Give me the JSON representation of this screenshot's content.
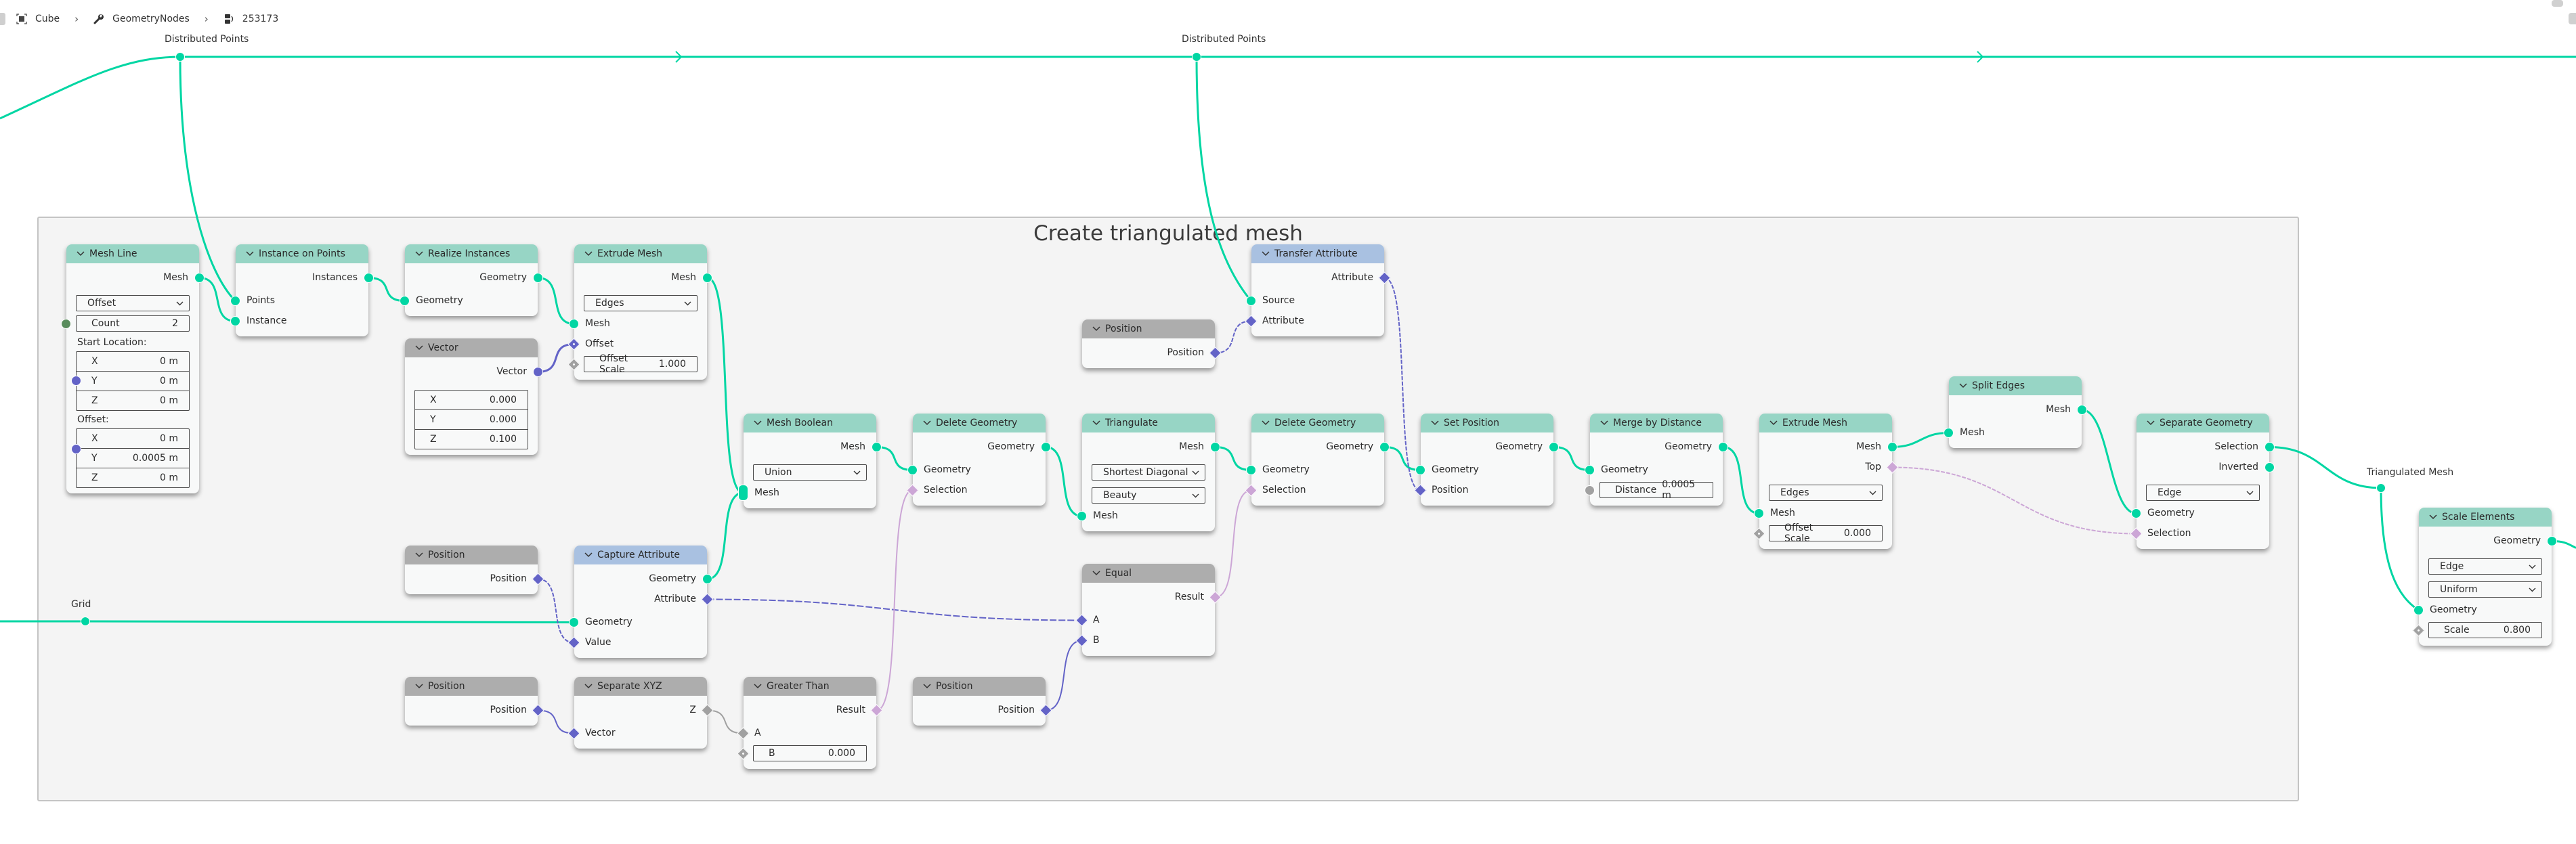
{
  "breadcrumb": {
    "items": [
      {
        "icon": "object-icon",
        "label": "Cube"
      },
      {
        "icon": "wrench-icon",
        "label": "GeometryNodes"
      },
      {
        "icon": "node-tree-icon",
        "label": "253173"
      }
    ]
  },
  "frame": {
    "title": "Create triangulated mesh"
  },
  "reroutes": {
    "distributed_points_1": "Distributed Points",
    "distributed_points_2": "Distributed Points",
    "grid": "Grid",
    "triangulated_mesh": "Triangulated Mesh"
  },
  "colors": {
    "geometry_socket": "#00d6a3",
    "vector_socket": "#6363c7",
    "boolean_socket": "#cca6d6",
    "float_socket": "#a1a1a1",
    "integer_socket": "#598c5c",
    "geometry_header": "#97d5c5",
    "input_header": "#adadad",
    "attribute_header": "#a9c1e1",
    "frame_bg": "#f4f4f4"
  },
  "nodes": {
    "mesh_line": {
      "title": "Mesh Line",
      "out_mesh": "Mesh",
      "mode": "Offset",
      "count_label": "Count",
      "count_value": "2",
      "start_label": "Start Location:",
      "start": [
        {
          "axis": "X",
          "value": "0 m"
        },
        {
          "axis": "Y",
          "value": "0 m"
        },
        {
          "axis": "Z",
          "value": "0 m"
        }
      ],
      "offset_label": "Offset:",
      "offset": [
        {
          "axis": "X",
          "value": "0 m"
        },
        {
          "axis": "Y",
          "value": "0.0005 m"
        },
        {
          "axis": "Z",
          "value": "0 m"
        }
      ]
    },
    "instance_on_points": {
      "title": "Instance on Points",
      "out_instances": "Instances",
      "in_points": "Points",
      "in_instance": "Instance"
    },
    "realize_instances": {
      "title": "Realize Instances",
      "out_geometry": "Geometry",
      "in_geometry": "Geometry"
    },
    "vector": {
      "title": "Vector",
      "out_vector": "Vector",
      "values": [
        {
          "axis": "X",
          "value": "0.000"
        },
        {
          "axis": "Y",
          "value": "0.000"
        },
        {
          "axis": "Z",
          "value": "0.100"
        }
      ]
    },
    "extrude_mesh_1": {
      "title": "Extrude Mesh",
      "out_mesh": "Mesh",
      "mode": "Edges",
      "in_mesh": "Mesh",
      "in_offset": "Offset",
      "offset_scale_label": "Offset Scale",
      "offset_scale_value": "1.000"
    },
    "mesh_boolean": {
      "title": "Mesh Boolean",
      "out_mesh": "Mesh",
      "operation": "Union",
      "in_mesh": "Mesh"
    },
    "delete_geometry_1": {
      "title": "Delete Geometry",
      "out_geometry": "Geometry",
      "in_geometry": "Geometry",
      "in_selection": "Selection"
    },
    "triangulate": {
      "title": "Triangulate",
      "out_mesh": "Mesh",
      "quad_method": "Shortest Diagonal",
      "ngon_method": "Beauty",
      "in_mesh": "Mesh"
    },
    "position_1": {
      "title": "Position",
      "out_position": "Position"
    },
    "transfer_attribute": {
      "title": "Transfer Attribute",
      "out_attribute": "Attribute",
      "in_source": "Source",
      "in_attribute": "Attribute"
    },
    "delete_geometry_2": {
      "title": "Delete Geometry",
      "out_geometry": "Geometry",
      "in_geometry": "Geometry",
      "in_selection": "Selection"
    },
    "set_position": {
      "title": "Set Position",
      "out_geometry": "Geometry",
      "in_geometry": "Geometry",
      "in_position": "Position"
    },
    "merge_by_distance": {
      "title": "Merge by Distance",
      "out_geometry": "Geometry",
      "in_geometry": "Geometry",
      "distance_label": "Distance",
      "distance_value": "0.0005 m"
    },
    "extrude_mesh_2": {
      "title": "Extrude Mesh",
      "out_mesh": "Mesh",
      "out_top": "Top",
      "mode": "Edges",
      "in_mesh": "Mesh",
      "offset_scale_label": "Offset Scale",
      "offset_scale_value": "0.000"
    },
    "split_edges": {
      "title": "Split Edges",
      "out_mesh": "Mesh",
      "in_mesh": "Mesh"
    },
    "separate_geometry": {
      "title": "Separate Geometry",
      "out_selection": "Selection",
      "out_inverted": "Inverted",
      "domain": "Edge",
      "in_geometry": "Geometry",
      "in_selection": "Selection"
    },
    "scale_elements": {
      "title": "Scale Elements",
      "out_geometry": "Geometry",
      "domain": "Edge",
      "scale_mode": "Uniform",
      "in_geometry": "Geometry",
      "scale_label": "Scale",
      "scale_value": "0.800"
    },
    "position_2": {
      "title": "Position",
      "out_position": "Position"
    },
    "capture_attribute": {
      "title": "Capture Attribute",
      "out_geometry": "Geometry",
      "out_attribute": "Attribute",
      "in_geometry": "Geometry",
      "in_value": "Value"
    },
    "equal": {
      "title": "Equal",
      "out_result": "Result",
      "in_a": "A",
      "in_b": "B"
    },
    "position_3": {
      "title": "Position",
      "out_position": "Position"
    },
    "separate_xyz": {
      "title": "Separate XYZ",
      "out_z": "Z",
      "in_vector": "Vector"
    },
    "greater_than": {
      "title": "Greater Than",
      "out_result": "Result",
      "in_a": "A",
      "b_label": "B",
      "b_value": "0.000"
    },
    "position_4": {
      "title": "Position",
      "out_position": "Position"
    }
  }
}
